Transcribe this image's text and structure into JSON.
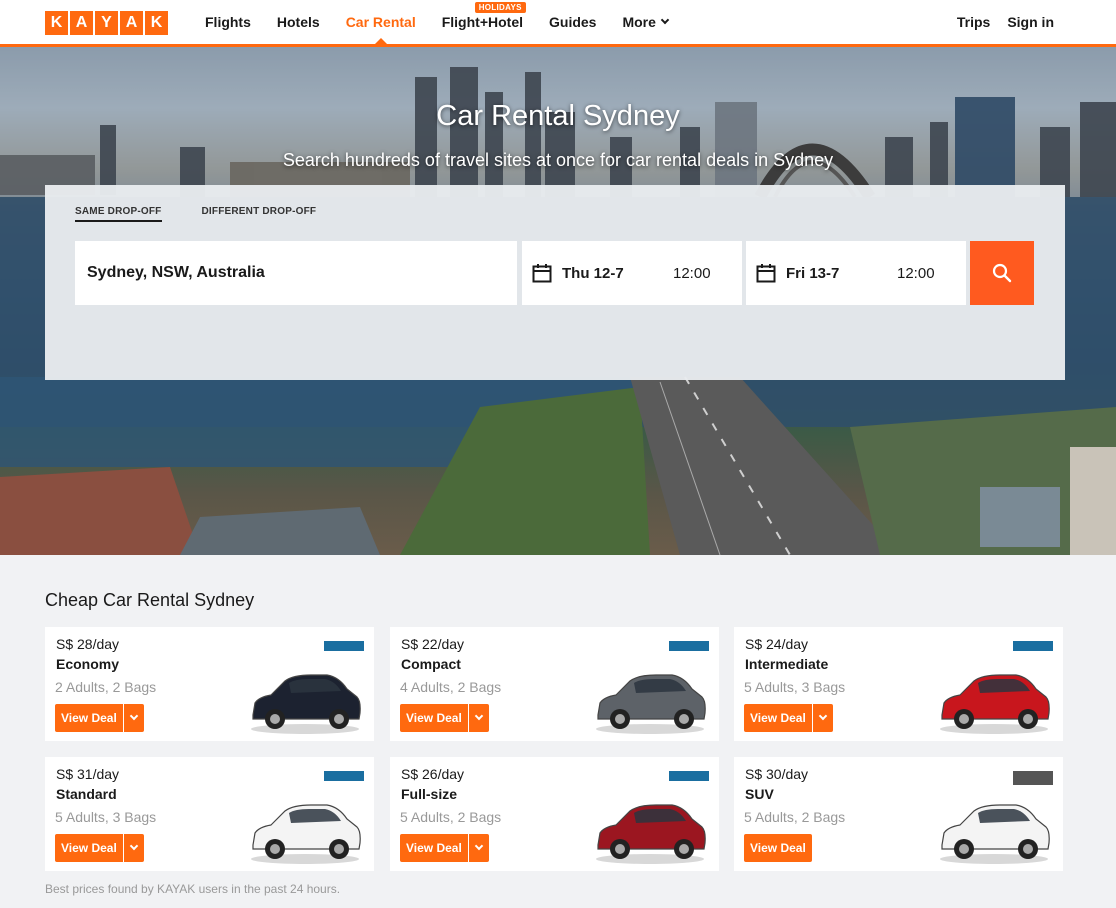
{
  "brand": {
    "letters": [
      "K",
      "A",
      "Y",
      "A",
      "K"
    ],
    "accent": "#ff690f"
  },
  "nav": {
    "items": [
      "Flights",
      "Hotels",
      "Car Rental",
      "Flight+Hotel",
      "Guides",
      "More"
    ],
    "active": "Car Rental",
    "badge": "HOLIDAYS",
    "right": [
      "Trips",
      "Sign in"
    ]
  },
  "hero": {
    "title": "Car Rental Sydney",
    "subtitle": "Search hundreds of travel sites at once for car rental deals in Sydney"
  },
  "search": {
    "tabs": [
      "SAME DROP-OFF",
      "DIFFERENT DROP-OFF"
    ],
    "location": "Sydney, NSW, Australia",
    "pickup": {
      "date": "Thu 12-7",
      "time": "12:00"
    },
    "dropoff": {
      "date": "Fri 13-7",
      "time": "12:00"
    },
    "button_icon": "search-icon"
  },
  "deals": {
    "title": "Cheap Car Rental Sydney",
    "button_label": "View Deal",
    "cards": [
      {
        "price": "S$ 28/day",
        "class": "Economy",
        "capacity": "2 Adults, 2 Bags",
        "color": "#1c2230"
      },
      {
        "price": "S$ 22/day",
        "class": "Compact",
        "capacity": "4 Adults, 2 Bags",
        "color": "#5d6268"
      },
      {
        "price": "S$ 24/day",
        "class": "Intermediate",
        "capacity": "5 Adults, 3 Bags",
        "color": "#c8161d"
      },
      {
        "price": "S$ 31/day",
        "class": "Standard",
        "capacity": "5 Adults, 3 Bags",
        "color": "#f4f4f4"
      },
      {
        "price": "S$ 26/day",
        "class": "Full-size",
        "capacity": "5 Adults, 2 Bags",
        "color": "#9b1620"
      },
      {
        "price": "S$ 30/day",
        "class": "SUV",
        "capacity": "5 Adults, 2 Bags",
        "color": "#f4f4f4"
      }
    ],
    "footnote": "Best prices found by KAYAK users in the past 24 hours."
  }
}
